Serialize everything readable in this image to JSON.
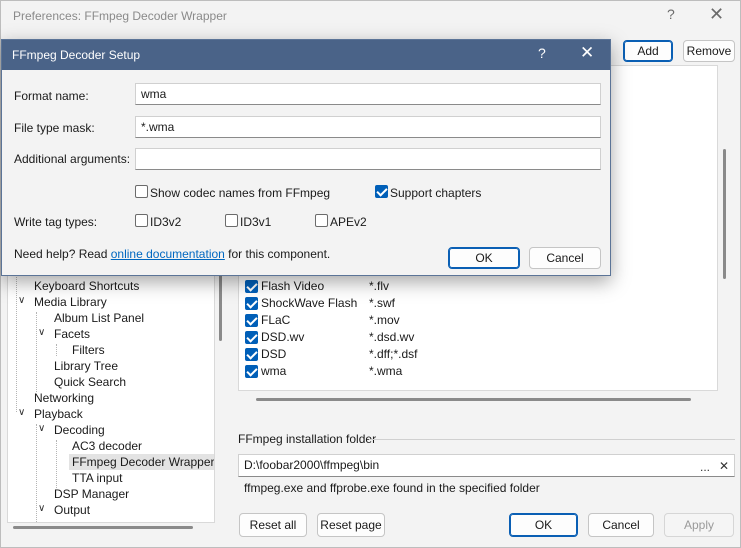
{
  "prefs": {
    "title": "Preferences: FFmpeg Decoder Wrapper",
    "help_glyph": "?",
    "close_glyph": "✕",
    "add_label": "Add",
    "remove_label": "Remove",
    "tree": [
      {
        "label": "Keyboard Shortcuts",
        "expander": ""
      },
      {
        "label": "Media Library",
        "expander": "∨"
      },
      {
        "label": "Album List Panel",
        "expander": ""
      },
      {
        "label": "Facets",
        "expander": "∨"
      },
      {
        "label": "Filters",
        "expander": ""
      },
      {
        "label": "Library Tree",
        "expander": ""
      },
      {
        "label": "Quick Search",
        "expander": ""
      },
      {
        "label": "Networking",
        "expander": ""
      },
      {
        "label": "Playback",
        "expander": "∨"
      },
      {
        "label": "Decoding",
        "expander": "∨"
      },
      {
        "label": "AC3 decoder",
        "expander": ""
      },
      {
        "label": "FFmpeg Decoder Wrapper",
        "expander": ""
      },
      {
        "label": "TTA input",
        "expander": ""
      },
      {
        "label": "DSP Manager",
        "expander": ""
      },
      {
        "label": "Output",
        "expander": "∨"
      }
    ],
    "formats": [
      {
        "name": "Flash Video",
        "mask": "*.flv",
        "checked": true
      },
      {
        "name": "ShockWave Flash",
        "mask": "*.swf",
        "checked": true
      },
      {
        "name": "FLaC",
        "mask": "*.mov",
        "checked": true
      },
      {
        "name": "DSD.wv",
        "mask": "*.dsd.wv",
        "checked": true
      },
      {
        "name": "DSD",
        "mask": "*.dff;*.dsf",
        "checked": true
      },
      {
        "name": "wma",
        "mask": "*.wma",
        "checked": true
      }
    ],
    "folder_section_label": "FFmpeg installation folder",
    "folder_value": "D:\\foobar2000\\ffmpeg\\bin",
    "folder_more": "...",
    "folder_clear": "✕",
    "status": "ffmpeg.exe and ffprobe.exe found in the specified folder",
    "reset_all_label": "Reset all",
    "reset_page_label": "Reset page",
    "ok_label": "OK",
    "cancel_label": "Cancel",
    "apply_label": "Apply"
  },
  "dialog": {
    "title": "FFmpeg Decoder Setup",
    "help_glyph": "?",
    "close_glyph": "✕",
    "format_name_label": "Format name:",
    "format_name_value": "wma",
    "mask_label": "File type mask:",
    "mask_value": "*.wma",
    "args_label": "Additional arguments:",
    "args_value": "",
    "show_codec_label": "Show codec names from FFmpeg",
    "show_codec_checked": false,
    "support_chapters_label": "Support chapters",
    "support_chapters_checked": true,
    "write_tag_label": "Write tag types:",
    "id3v2_label": "ID3v2",
    "id3v1_label": "ID3v1",
    "apev2_label": "APEv2",
    "help_prefix": "Need help? Read ",
    "help_link": "online documentation",
    "help_suffix": " for this component.",
    "ok_label": "OK",
    "cancel_label": "Cancel"
  }
}
